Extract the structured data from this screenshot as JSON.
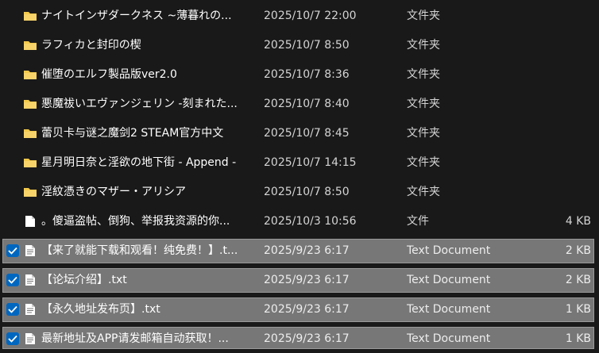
{
  "files": [
    {
      "name": "ナイトインザダークネス ~薄暮れの...",
      "date": "2025/10/7 22:00",
      "type": "文件夹",
      "size": "",
      "kind": "folder",
      "selected": false
    },
    {
      "name": "ラフィカと封印の楔",
      "date": "2025/10/7 8:50",
      "type": "文件夹",
      "size": "",
      "kind": "folder",
      "selected": false
    },
    {
      "name": "催堕のエルフ製品版ver2.0",
      "date": "2025/10/7 8:36",
      "type": "文件夹",
      "size": "",
      "kind": "folder",
      "selected": false
    },
    {
      "name": "悪魔祓いエヴァンジェリン -刻まれた...",
      "date": "2025/10/7 8:40",
      "type": "文件夹",
      "size": "",
      "kind": "folder",
      "selected": false
    },
    {
      "name": "蕾贝卡与谜之魔剑2  STEAM官方中文",
      "date": "2025/10/7 8:45",
      "type": "文件夹",
      "size": "",
      "kind": "folder",
      "selected": false
    },
    {
      "name": "星月明日奈と淫欲の地下街 - Append -",
      "date": "2025/10/7 14:15",
      "type": "文件夹",
      "size": "",
      "kind": "folder",
      "selected": false
    },
    {
      "name": "淫紋憑きのマザー・アリシア",
      "date": "2025/10/7 8:50",
      "type": "文件夹",
      "size": "",
      "kind": "folder",
      "selected": false
    },
    {
      "name": "。傻逼盗帖、倒狗、举报我资源的你...",
      "date": "2025/10/3 10:56",
      "type": "文件",
      "size": "4 KB",
      "kind": "file",
      "selected": false
    },
    {
      "name": "【来了就能下载和观看！纯免费！】.t...",
      "date": "2025/9/23 6:17",
      "type": "Text Document",
      "size": "2 KB",
      "kind": "text",
      "selected": true
    },
    {
      "name": "【论坛介绍】.txt",
      "date": "2025/9/23 6:17",
      "type": "Text Document",
      "size": "2 KB",
      "kind": "text",
      "selected": true
    },
    {
      "name": "【永久地址发布页】.txt",
      "date": "2025/9/23 6:17",
      "type": "Text Document",
      "size": "1 KB",
      "kind": "text",
      "selected": true
    },
    {
      "name": "最新地址及APP请发邮箱自动获取！...",
      "date": "2025/9/23 6:17",
      "type": "Text Document",
      "size": "1 KB",
      "kind": "text",
      "selected": true
    }
  ],
  "colors": {
    "background": "#191919",
    "folder": "#f2c94c",
    "selection": "#777777",
    "checkbox": "#0067c0"
  },
  "icons": {
    "folder": "folder-icon",
    "file": "file-icon",
    "text": "text-document-icon",
    "check": "checkmark-icon"
  }
}
